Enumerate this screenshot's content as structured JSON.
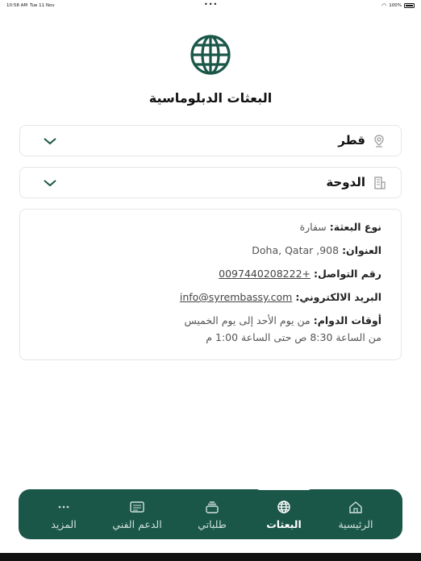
{
  "status": {
    "time": "10:58 AM",
    "date": "Tue 11 Nov",
    "battery": "100%"
  },
  "page": {
    "title": "البعثات الدبلوماسية"
  },
  "country_select": {
    "value": "قطر",
    "icon": "map-pin-icon"
  },
  "city_select": {
    "value": "الدوحة",
    "icon": "building-icon"
  },
  "mission": {
    "type_label": "نوع البعثة:",
    "type_value": "سفارة",
    "address_label": "العنوان:",
    "address_value": "Doha, Qatar ,908",
    "phone_label": "رقم التواصل:",
    "phone_value": "+0097440208222",
    "email_label": "البريد الالكتروني:",
    "email_value": "info@syrembassy.com",
    "hours_label": "أوقات الدوام:",
    "hours_days": "من يوم الأحد إلى يوم الخميس",
    "hours_time": "من الساعة 8:30 ص حتى الساعة 1:00 م"
  },
  "tabs": [
    {
      "label": "الرئيسية",
      "icon": "home-icon",
      "active": false
    },
    {
      "label": "البعثات",
      "icon": "globe-icon",
      "active": true
    },
    {
      "label": "طلباتي",
      "icon": "stack-icon",
      "active": false
    },
    {
      "label": "الدعم الفني",
      "icon": "support-card-icon",
      "active": false
    },
    {
      "label": "المزيد",
      "icon": "more-icon",
      "active": false
    }
  ],
  "colors": {
    "brand": "#1b5748",
    "text": "#222222"
  }
}
